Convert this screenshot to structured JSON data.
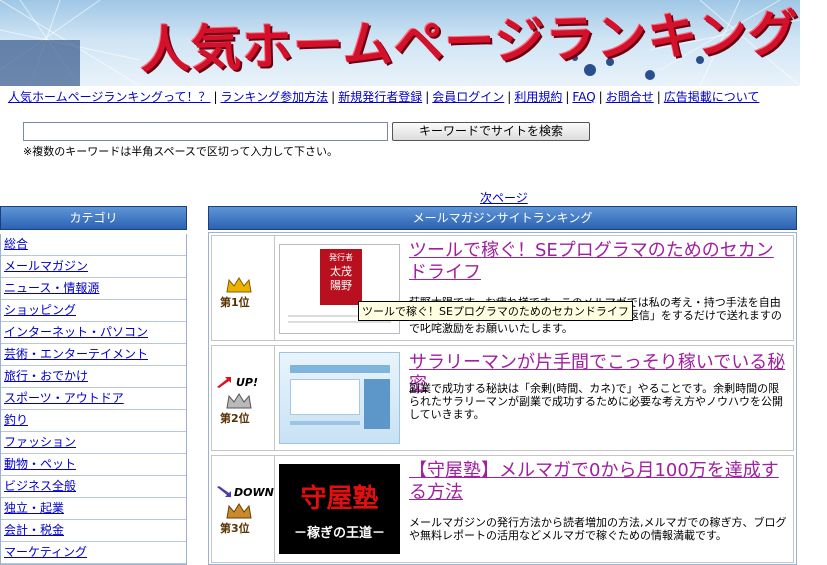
{
  "header": {
    "banner_title": "人気ホームページランキング"
  },
  "topnav": [
    "人気ホームページランキングって！？",
    "ランキング参加方法",
    "新規発行者登録",
    "会員ログイン",
    "利用規約",
    "FAQ",
    "お問合せ",
    "広告掲載について"
  ],
  "search": {
    "value": "",
    "button_label": "キーワードでサイトを検索",
    "note": "※複数のキーワードは半角スペースで区切って入力して下さい。"
  },
  "pager": {
    "next_label": "次ページ"
  },
  "sidebar": {
    "title": "カテゴリ",
    "items": [
      "総合",
      "メールマガジン",
      "ニュース・情報源",
      "ショッピング",
      "インターネット・パソコン",
      "芸術・エンターテイメント",
      "旅行・おでかけ",
      "スポーツ・アウトドア",
      "釣り",
      "ファッション",
      "動物・ペット",
      "ビジネス全般",
      "独立・起業",
      "会計・税金",
      "マーケティング"
    ]
  },
  "ranking": {
    "title": "メールマガジンサイトランキング",
    "entries": [
      {
        "rank_label": "第1位",
        "trend": "",
        "title": "ツールで稼ぐ！SEプログラマのためのセカンドライフ",
        "description": "萩野太陽です。お疲れ様です。このメルマガでは私の考え・持つ手法を自由に発信します。感想メールは、メルマガに「返信」をするだけで送れますので叱咤激励をお願いいたします。",
        "thumb_text": [
          "発行者",
          "太茂",
          "陽野"
        ]
      },
      {
        "rank_label": "第2位",
        "trend": "UP!",
        "title": "サラリーマンが片手間でこっそり稼いでいる秘密",
        "description": "副業で成功する秘訣は「余剰(時間、カネ)で」やることです。余剰時間の限られたサラリーマンが副業で成功するために必要な考え方やノウハウを公開していきます。",
        "thumb_text": []
      },
      {
        "rank_label": "第3位",
        "trend": "DOWN",
        "title": "【守屋塾】メルマガで0から月100万を達成する方法",
        "description": "メールマガジンの発行方法から読者増加の方法,メルマガでの稼ぎ方、ブログや無料レポートの活用などメルマガで稼ぐための情報満載です。",
        "thumb_text": [
          "守屋塾",
          "－稼ぎの王道－"
        ]
      }
    ]
  },
  "tooltip": "ツールで稼ぐ！SEプログラマのためのセカンドライフ",
  "colors": {
    "banner_title": "#d3112b",
    "header_bar": "#2b62b3",
    "link": "#0000cc",
    "visited_title": "#a020a0"
  }
}
